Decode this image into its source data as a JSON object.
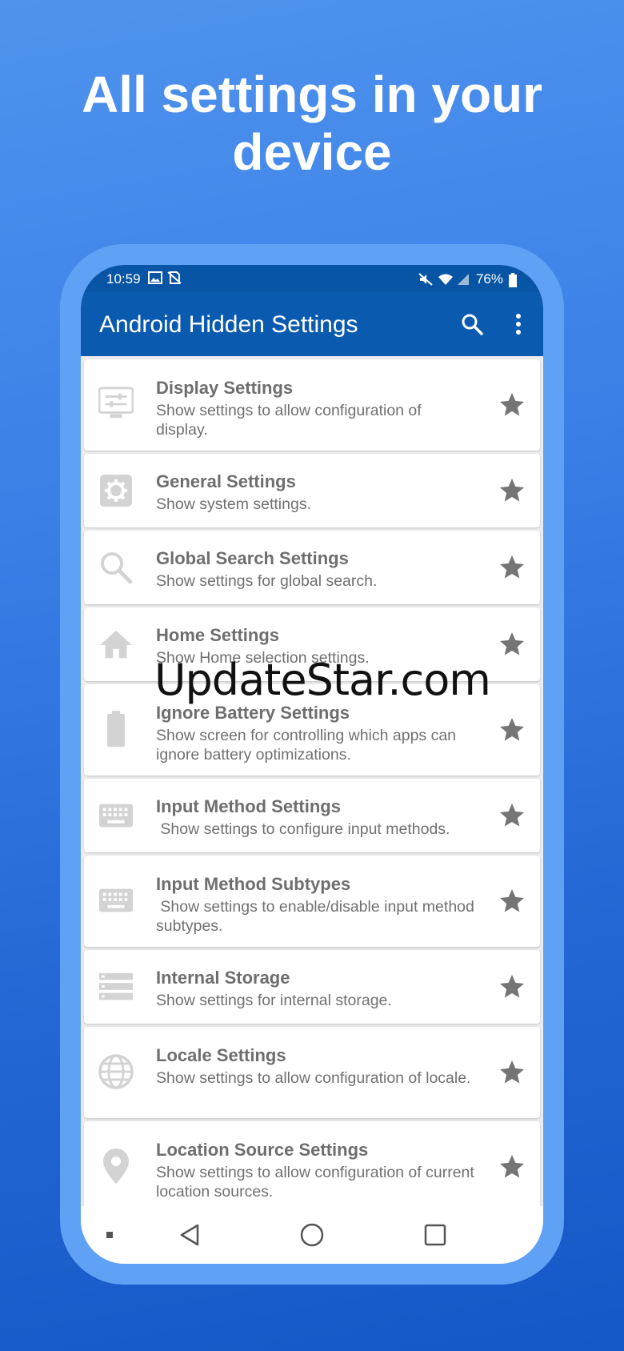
{
  "hero": {
    "title_line1": "All settings in your",
    "title_line2": "device"
  },
  "status_bar": {
    "time": "10:59",
    "battery": "76%"
  },
  "app_bar": {
    "title": "Android Hidden Settings"
  },
  "items": [
    {
      "title": "Display Settings",
      "desc": "Show settings to allow configuration of display.",
      "icon": "display-settings-icon"
    },
    {
      "title": "General Settings",
      "desc": "Show system settings.",
      "icon": "gear-icon"
    },
    {
      "title": "Global Search Settings",
      "desc": "Show settings for global search.",
      "icon": "search-icon"
    },
    {
      "title": "Home Settings",
      "desc": "Show Home selection settings.",
      "icon": "home-icon"
    },
    {
      "title": "Ignore Battery Settings",
      "desc": "Show screen for controlling which apps can ignore battery optimizations.",
      "icon": "battery-icon"
    },
    {
      "title": "Input Method Settings",
      "desc": " Show settings to configure input methods.",
      "icon": "keyboard-icon"
    },
    {
      "title": "Input Method Subtypes",
      "desc": " Show settings to enable/disable input method subtypes.",
      "icon": "keyboard-icon"
    },
    {
      "title": "Internal Storage",
      "desc": "Show settings for internal storage.",
      "icon": "storage-icon"
    },
    {
      "title": "Locale Settings",
      "desc": "Show settings to allow configuration of locale.",
      "icon": "globe-icon"
    },
    {
      "title": "Location Source Settings",
      "desc": "Show settings to allow configuration of current location sources.",
      "icon": "location-pin-icon"
    }
  ],
  "watermark": "UpdateStar.com",
  "colors": {
    "status_bar": "#0855a6",
    "app_bar": "#0a5ab0",
    "icon_gray": "#d3d3d3",
    "star_gray": "#757575"
  }
}
